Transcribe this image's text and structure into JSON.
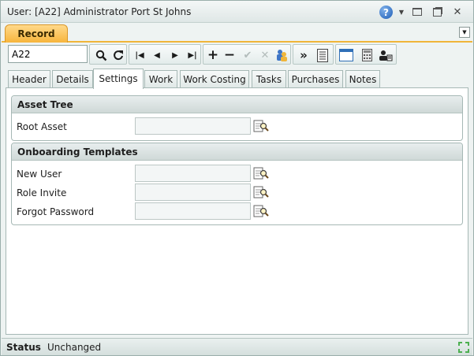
{
  "window": {
    "title": "User: [A22] Administrator Port St Johns"
  },
  "record_tab": {
    "label": "Record"
  },
  "toolbar": {
    "record_id": "A22"
  },
  "tabs": [
    {
      "label": "Header"
    },
    {
      "label": "Details"
    },
    {
      "label": "Settings",
      "active": true
    },
    {
      "label": "Work"
    },
    {
      "label": "Work Costing"
    },
    {
      "label": "Tasks"
    },
    {
      "label": "Purchases"
    },
    {
      "label": "Notes"
    }
  ],
  "sections": {
    "asset_tree": {
      "title": "Asset Tree",
      "fields": [
        {
          "label": "Root Asset",
          "value": ""
        }
      ]
    },
    "onboarding": {
      "title": "Onboarding Templates",
      "fields": [
        {
          "label": "New User",
          "value": ""
        },
        {
          "label": "Role Invite",
          "value": ""
        },
        {
          "label": "Forgot Password",
          "value": ""
        }
      ]
    }
  },
  "status": {
    "label": "Status",
    "value": "Unchanged"
  },
  "icons": {
    "help": "help-icon",
    "search": "search-icon",
    "refresh": "refresh-icon",
    "first": "first-record-icon",
    "prev": "previous-record-icon",
    "next": "next-record-icon",
    "last": "last-record-icon",
    "add": "add-icon",
    "remove": "remove-icon",
    "save": "check-icon",
    "cancel": "cancel-icon",
    "lookup": "lookup-icon"
  },
  "colors": {
    "record_tab": "#f7b53c",
    "accent_border": "#f0b53a",
    "help": "#1f5eb6"
  }
}
